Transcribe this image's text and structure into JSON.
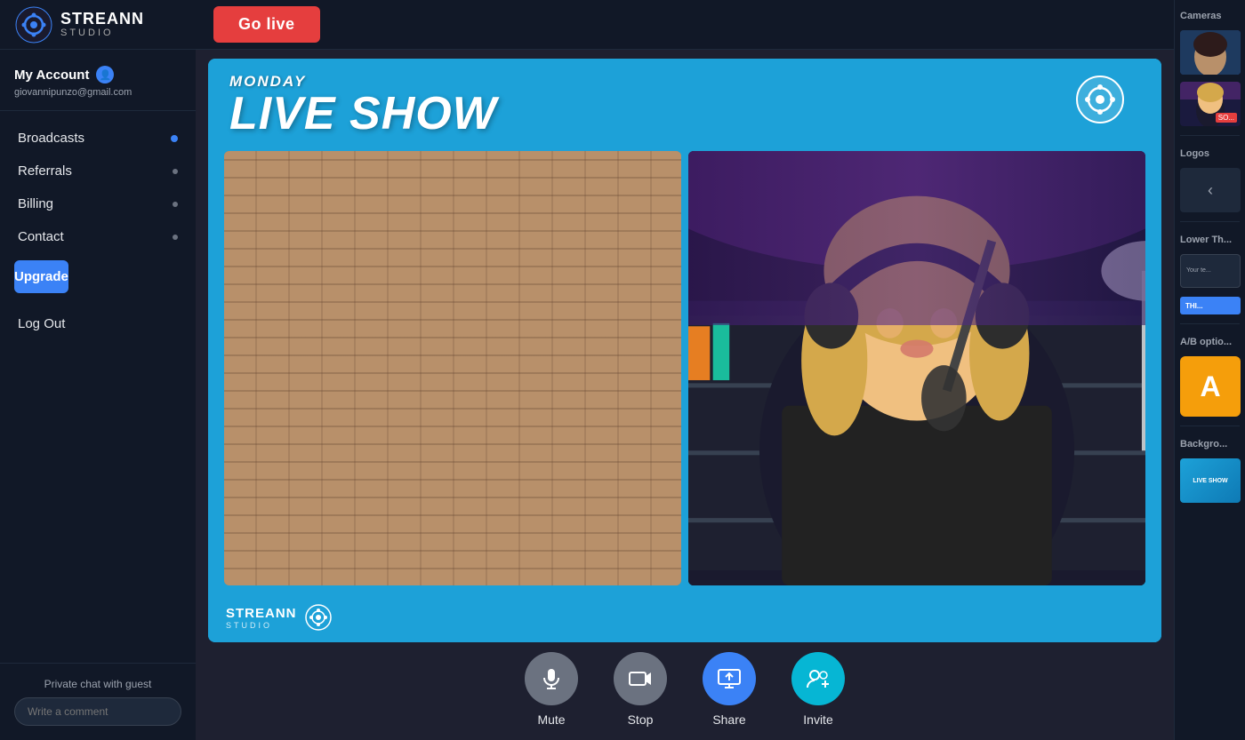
{
  "app": {
    "name": "STREANN",
    "subtitle": "STUDIO"
  },
  "sidebar": {
    "account_label": "My Account",
    "email": "giovannipunzo@gmail.com",
    "nav_items": [
      {
        "label": "Broadcasts",
        "dot": "blue"
      },
      {
        "label": "Referrals",
        "dot": "grey"
      },
      {
        "label": "Billing",
        "dot": "grey"
      },
      {
        "label": "Contact",
        "dot": "grey"
      }
    ],
    "upgrade_label": "Upgrade",
    "logout_label": "Log Out",
    "private_chat_label": "Private chat with guest",
    "comment_placeholder": "Write a comment"
  },
  "topbar": {
    "go_live_label": "Go live"
  },
  "stage": {
    "day_label": "MONDAY",
    "show_title": "LIVE SHOW"
  },
  "controls": [
    {
      "id": "mute",
      "label": "Mute",
      "style": "grey",
      "icon": "🎤"
    },
    {
      "id": "stop",
      "label": "Stop",
      "style": "grey",
      "icon": "🎥"
    },
    {
      "id": "share",
      "label": "Share",
      "style": "blue",
      "icon": "🖥"
    },
    {
      "id": "invite",
      "label": "Invite",
      "style": "teal",
      "icon": "👥"
    }
  ],
  "right_panel": {
    "cameras_label": "Cameras",
    "logos_label": "Logos",
    "lower_thirds_label": "Lower Th...",
    "ab_options_label": "A/B optio...",
    "backgrounds_label": "Backgro...",
    "ab_letter": "A"
  }
}
